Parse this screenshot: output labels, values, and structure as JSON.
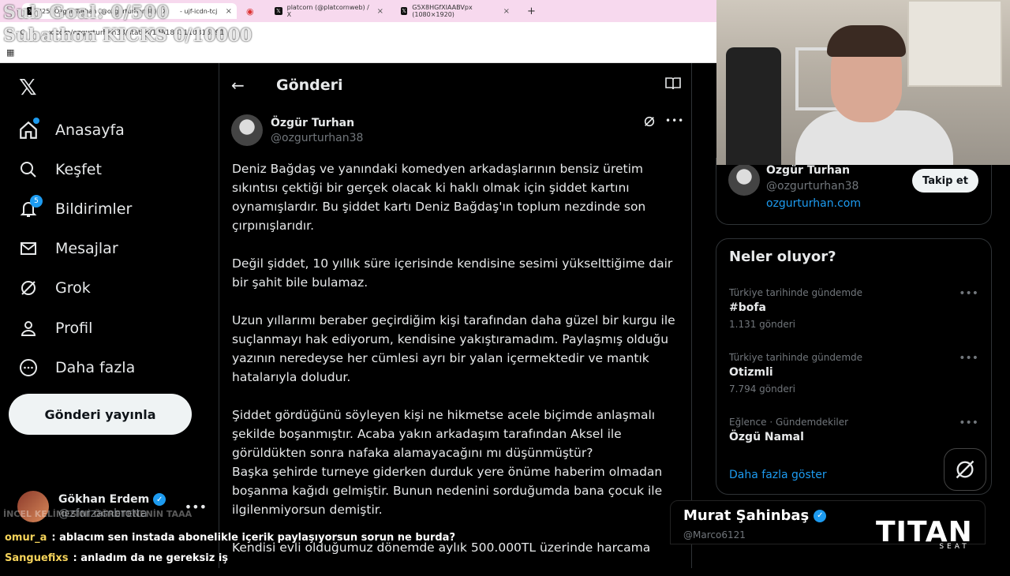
{
  "browser": {
    "tabs": [
      {
        "label": "(25) Özgür Turhan (@ozgurturhan38) / X"
      },
      {
        "label": "- ujf-icdn-tcj"
      },
      {
        "label": "platcorn (@platcornweb) / X"
      },
      {
        "label": "G5X8HGfXIAABVpx (1080×1920)"
      }
    ],
    "url": "x.com/ozgurturhan38/status/1981883110316591"
  },
  "overlay": {
    "line1": "Sub Goal: 0/500",
    "line2": "Subathon KICKS 0/10000"
  },
  "nav": {
    "items": [
      {
        "label": "Anasayfa"
      },
      {
        "label": "Keşfet"
      },
      {
        "label": "Bildirimler",
        "badge": "5"
      },
      {
        "label": "Mesajlar"
      },
      {
        "label": "Grok"
      },
      {
        "label": "Profil"
      },
      {
        "label": "Daha fazla"
      }
    ],
    "post_button": "Gönderi yayınla",
    "account": {
      "name": "Gökhan Erdem",
      "handle": "@zforzambrotta"
    }
  },
  "main": {
    "title": "Gönderi",
    "author": {
      "name": "Özgür Turhan",
      "handle": "@ozgurturhan38"
    },
    "paragraphs": [
      "Deniz Bağdaş ve yanındaki komedyen arkadaşlarının bensiz üretim sıkıntısı çektiği bir gerçek olacak ki haklı olmak için şiddet kartını oynamışlardır. Bu şiddet kartı Deniz Bağdaş'ın toplum nezdinde son çırpınışlarıdır.",
      "Değil şiddet, 10 yıllık süre içerisinde kendisine sesimi yükselttiğime dair bir şahit bile bulamaz.",
      "Uzun yıllarımı beraber geçirdiğim kişi tarafından daha güzel bir kurgu ile suçlanmayı hak ediyorum, kendisine yakıştıramadım. Paylaşmış olduğu yazının neredeyse her cümlesi ayrı bir yalan içermektedir ve mantık hatalarıyla doludur.",
      "Şiddet gördüğünü söyleyen kişi ne hikmetse acele biçimde anlaşmalı şekilde boşanmıştır. Acaba yakın arkadaşım tarafından Aksel ile görüldükten sonra nafaka alamayacağını mı düşünmüştür?",
      "Başka şehirde turneye giderken durduk yere önüme haberim olmadan boşanma kağıdı gelmiştir. Bunun nedenini sorduğumda bana çocuk ile ilgilenmiyorsun demiştir.",
      "Kendisi evli olduğumuz dönemde aylık 500.000TL üzerinde harcama"
    ]
  },
  "sidebar": {
    "profile": {
      "name": "Özgür Turhan",
      "handle": "@ozgurturhan38",
      "link": "ozgurturhan.com",
      "follow": "Takip et"
    },
    "trends_title": "Neler oluyor?",
    "trends": [
      {
        "category": "Türkiye tarihinde gündemde",
        "name": "#bofa",
        "count": "1.131 gönderi"
      },
      {
        "category": "Türkiye tarihinde gündemde",
        "name": "Otizmli",
        "count": "7.794 gönderi"
      },
      {
        "category": "Eğlence · Gündemdekiler",
        "name": "Özgü Namal",
        "count": ""
      }
    ],
    "show_more": "Daha fazla göster"
  },
  "stream": {
    "lower_third": {
      "name": "Murat Şahinbaş",
      "handle": "@Marco6121"
    },
    "brand": "TITAN",
    "brand_sub": "SEAT",
    "ghost_text": "İNCEL KELİMESİNİ ÖĞRETENENİN TAAA",
    "chat": [
      {
        "user": "omur_a",
        "msg": ": ablacım sen instada abonelikle içerik paylaşıyorsun sorun ne burda?"
      },
      {
        "user": "Sanguefixs",
        "msg": ": anladım da ne gereksiz iş"
      }
    ]
  }
}
